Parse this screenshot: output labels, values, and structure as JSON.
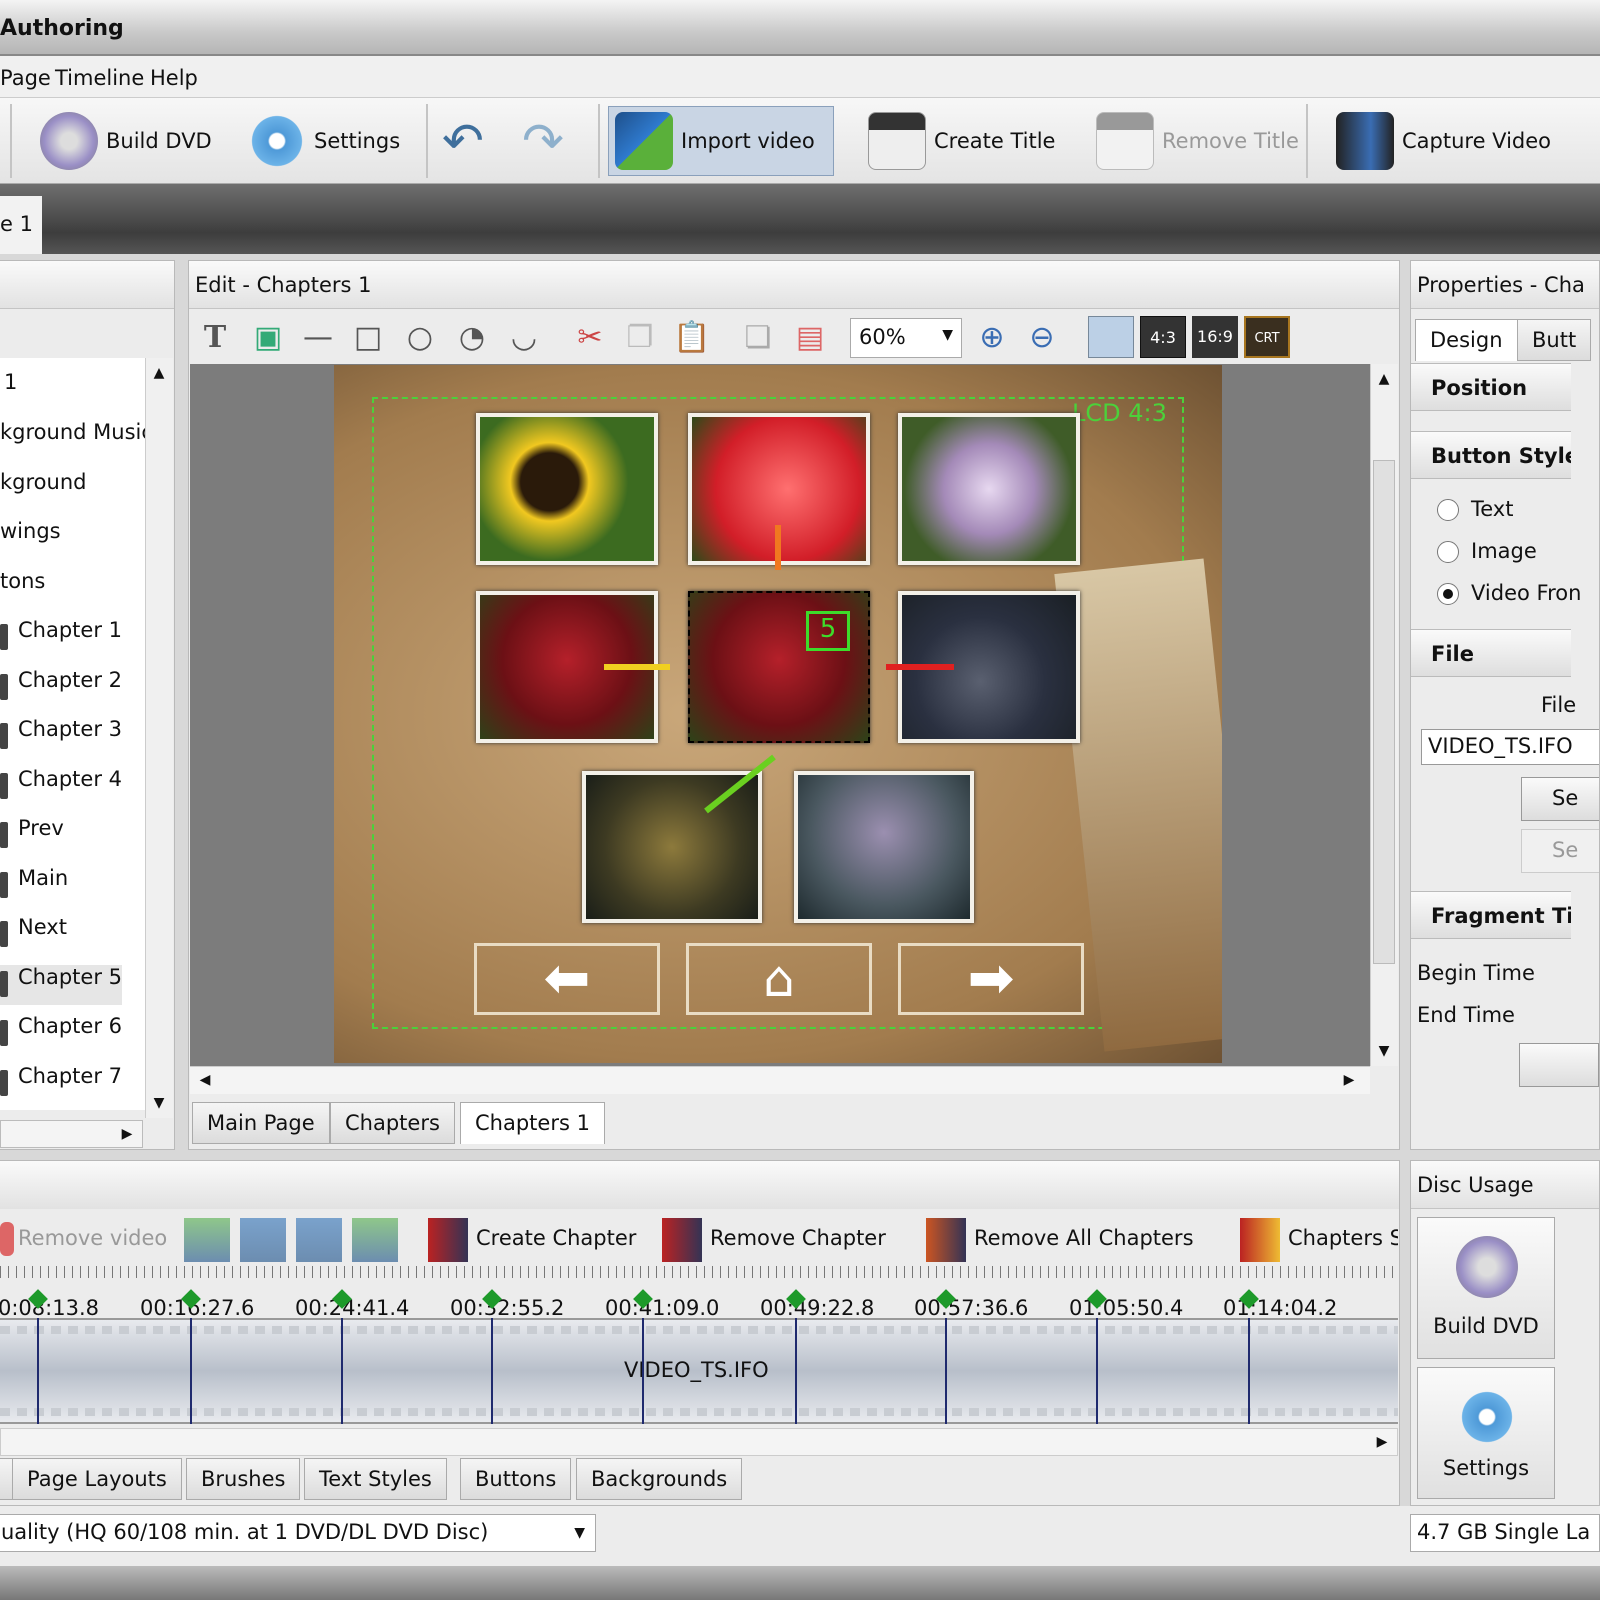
{
  "window": {
    "title": "Authoring"
  },
  "menu": [
    "Page",
    "Timeline",
    "Help"
  ],
  "toolbar": {
    "build_dvd": "Build DVD",
    "settings": "Settings",
    "import_video": "Import video",
    "create_title": "Create Title",
    "remove_title": "Remove Title",
    "capture_video": "Capture Video"
  },
  "doc_tab": "e 1",
  "left_panel": {
    "items": [
      "1",
      "kground Music",
      "kground",
      "wings",
      "tons",
      "Chapter 1",
      "Chapter 2",
      "Chapter 3",
      "Chapter 4",
      "Prev",
      "Main",
      "Next",
      "Chapter 5",
      "Chapter 6",
      "Chapter 7"
    ],
    "selected": "Chapter 5"
  },
  "editor": {
    "title": "Edit - Chapters 1",
    "zoom": "60%",
    "aspect_buttons": [
      "4:3",
      "16:9",
      "CRT"
    ],
    "overlay_label": "LCD 4:3",
    "selected_button_number": "5",
    "tabs": [
      "Main Page",
      "Chapters",
      "Chapters 1"
    ],
    "active_tab": "Chapters 1"
  },
  "properties": {
    "title": "Properties - Cha",
    "tabs": [
      "Design",
      "Butt"
    ],
    "sections": {
      "position": "Position",
      "button_style": "Button Style",
      "file": "File",
      "fragment": "Fragment Ti"
    },
    "radio_options": [
      "Text",
      "Image",
      "Video Fron"
    ],
    "radio_selected": "Video Fron",
    "file_label": "File",
    "file_value": "VIDEO_TS.IFO",
    "btn1": "Se",
    "btn2": "Se",
    "begin_time": "Begin Time",
    "end_time": "End Time"
  },
  "timeline": {
    "toolbar": {
      "remove_video": "Remove video",
      "create_chapter": "Create Chapter",
      "remove_chapter": "Remove Chapter",
      "remove_all_chapters": "Remove All Chapters",
      "chapters_s": "Chapters S"
    },
    "ticks": [
      "0:08:13.8",
      "00:16:27.6",
      "00:24:41.4",
      "00:32:55.2",
      "00:41:09.0",
      "00:49:22.8",
      "00:57:36.6",
      "01:05:50.4",
      "01:14:04.2"
    ],
    "clip": "VIDEO_TS.IFO"
  },
  "bottom_tabs": [
    "Page Layouts",
    "Brushes",
    "Text Styles",
    "Buttons",
    "Backgrounds"
  ],
  "quality": "uality (HQ 60/108 min. at 1 DVD/DL DVD Disc)",
  "disc": {
    "title": "Disc Usage",
    "build_dvd": "Build DVD",
    "settings": "Settings",
    "capacity": "4.7 GB Single La"
  }
}
